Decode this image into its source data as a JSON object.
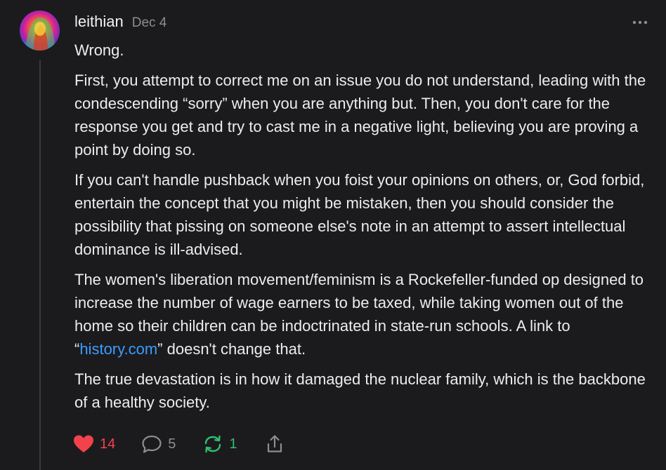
{
  "comment": {
    "author": "leithian",
    "date": "Dec 4",
    "paragraphs": [
      "Wrong.",
      "First, you attempt to correct me on an issue you do not understand, leading with the condescending “sorry” when you are anything but. Then, you don't care for the response you get and try to cast me in a negative light, believing you are proving a point by doing so.",
      "If you can't handle pushback when you foist your opinions on others, or, God forbid, entertain the concept that you might be mistaken, then you should consider the possibility that pissing on someone else's note in an attempt to assert intellectual dominance is ill-advised."
    ],
    "paragraph_with_link": {
      "before": "The women's liberation movement/feminism is a Rockefeller-funded op designed to increase the number of wage earners to be taxed, while taking women out of the home so their children can be indoctrinated in state-run schools. A link to “",
      "link_text": "history.com",
      "after": "” doesn't change that."
    },
    "last_paragraph": "The true devastation is in how it damaged the nuclear family, which is the backbone of a healthy society."
  },
  "actions": {
    "likes": "14",
    "comments": "5",
    "restacks": "1"
  },
  "icons": {
    "like": "heart-icon",
    "comment": "comment-bubble-icon",
    "restack": "restack-icon",
    "share": "share-icon",
    "more": "more-options-icon"
  },
  "colors": {
    "background": "#1b1b1d",
    "like": "#f2424c",
    "restack": "#2fbf71",
    "link": "#3b9cff",
    "muted": "#8d8d92"
  }
}
